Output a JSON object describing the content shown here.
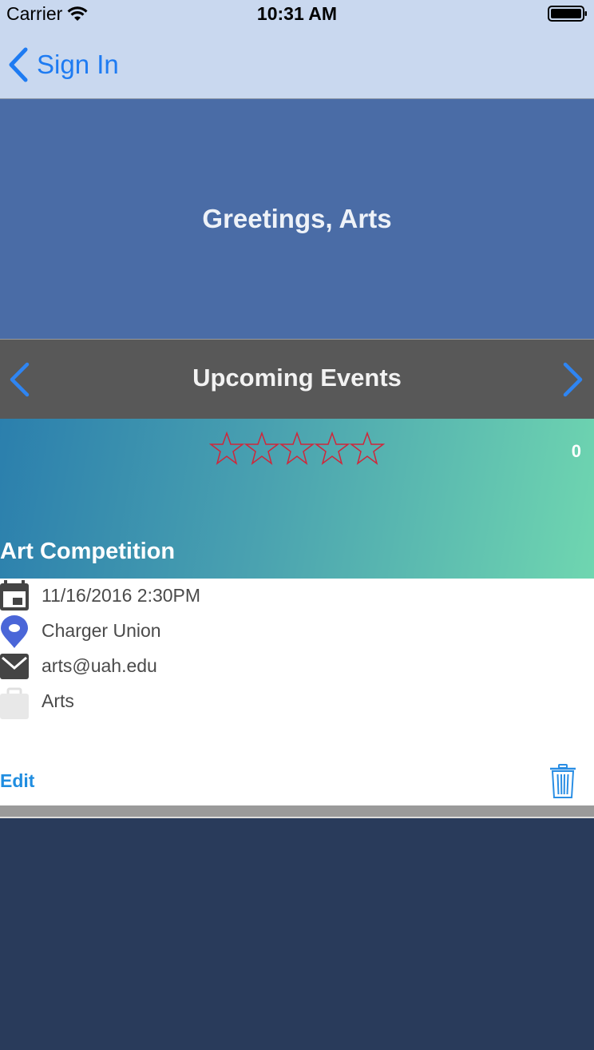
{
  "status_bar": {
    "carrier": "Carrier",
    "time": "10:31 AM"
  },
  "nav": {
    "back_label": "Sign In"
  },
  "greeting": {
    "text": "Greetings, Arts"
  },
  "events_bar": {
    "title": "Upcoming Events"
  },
  "event": {
    "rating": 0,
    "max_rating": 5,
    "rating_count": "0",
    "title": "Art Competition",
    "datetime": "11/16/2016 2:30PM",
    "location": "Charger Union",
    "email": "arts@uah.edu",
    "organization": "Arts",
    "edit_label": "Edit"
  },
  "colors": {
    "accent": "#1e7bf2",
    "greeting_bg": "#4a6ca6",
    "events_bar_bg": "#585858",
    "star_outline": "#d0263a",
    "bottom_bg": "#293b5b"
  },
  "icons": {
    "back": "chevron-left-icon",
    "prev": "chevron-left-icon",
    "next": "chevron-right-icon",
    "star": "star-outline-icon",
    "calendar": "calendar-icon",
    "location": "map-pin-icon",
    "email": "envelope-icon",
    "organization": "briefcase-icon",
    "delete": "trash-icon"
  }
}
